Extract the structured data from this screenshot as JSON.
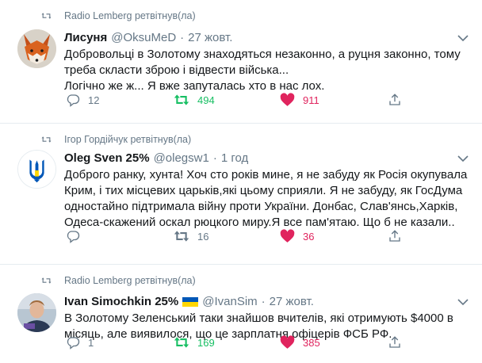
{
  "tweets": [
    {
      "retweeted_by": "Radio Lemberg ретвітнув(ла)",
      "author": {
        "name": "Лисуня",
        "handle": "@OksuMeD"
      },
      "time": "27 жовт.",
      "text_lines": [
        "Добровольці в Золотому знаходяться незаконно, а руцня законно, тому",
        "треба скласти зброю і відвести війська...",
        "Логічно же ж... Я вже запуталась хто в нас лох."
      ],
      "replies": "12",
      "retweets": "494",
      "likes": "911",
      "avatar_icon": "fox-avatar"
    },
    {
      "retweeted_by": "Ігор Гордійчук ретвітнув(ла)",
      "author": {
        "name": "Oleg Sven 25%",
        "handle": "@olegsw1"
      },
      "time": "1 год",
      "text_lines": [
        "Доброго ранку, хунта! Хоч сто років мине, я не забуду як Росія окупувала",
        "Крим, і тих місцевих царьків,які цьому сприяли. Я не забуду, як ГосДума",
        "одностайно підтримала війну проти України. Донбас, Слав'янсь,Харків,",
        "Одеса-скажений оскал рюцкого миру.Я все пам'ятаю. Що б не казали.."
      ],
      "replies": "",
      "retweets": "16",
      "likes": "36",
      "avatar_icon": "trident-avatar"
    },
    {
      "retweeted_by": "Radio Lemberg ретвітнув(ла)",
      "author": {
        "name": "Ivan Simochkin 25%",
        "handle": "@IvanSim"
      },
      "time": "27 жовт.",
      "text_lines": [
        "В Золотому Зеленський таки знайшов вчителів, які отримують $4000 в",
        "місяць, але виявилося, що це зарплатня офіцерів ФСБ РФ."
      ],
      "replies": "1",
      "retweets": "169",
      "likes": "385",
      "avatar_icon": "person-avatar"
    }
  ],
  "dot": "·",
  "colors": {
    "secondary_text": "#657786",
    "retweet_green": "#17bf63",
    "like_red": "#e0245e",
    "divider": "#e6ecf0",
    "ukraine_blue": "#0057b7",
    "ukraine_yellow": "#ffd700"
  }
}
